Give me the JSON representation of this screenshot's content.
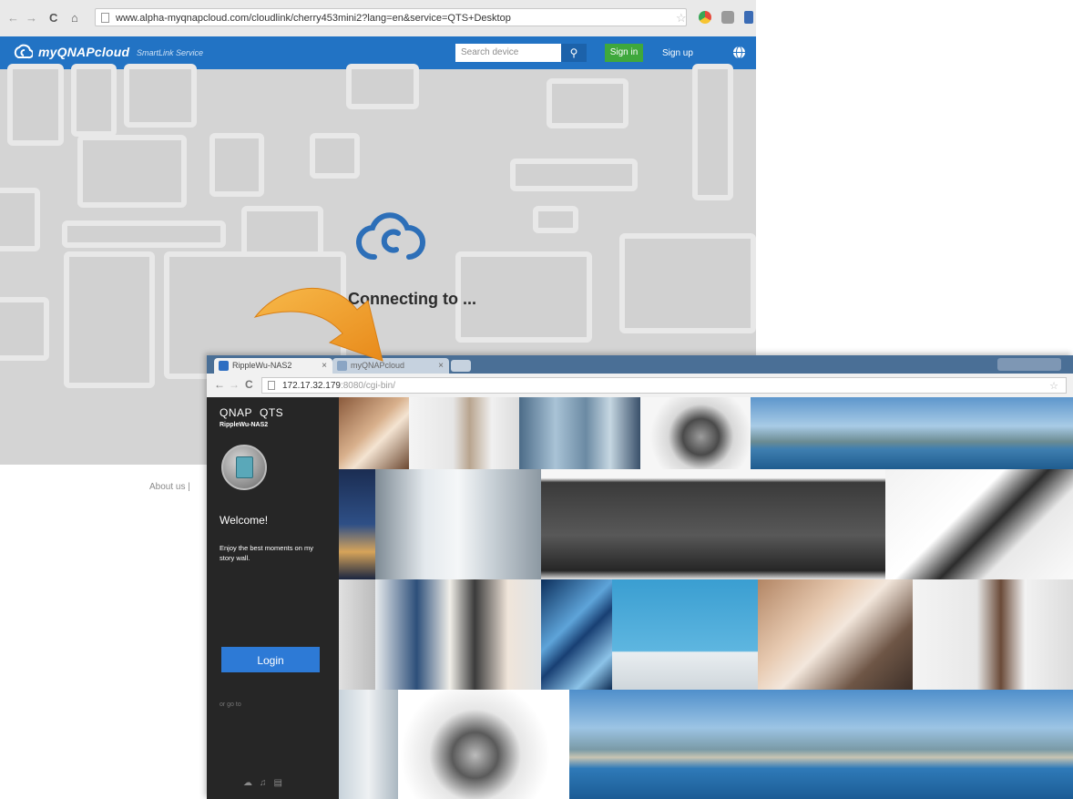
{
  "bg_browser": {
    "url": "www.alpha-myqnapcloud.com/cloudlink/cherry453mini2?lang=en&service=QTS+Desktop",
    "header": {
      "brand": "myQNAPcloud",
      "tagline": "SmartLink Service",
      "search_placeholder": "Search device",
      "signin_label": "Sign in",
      "signup_label": "Sign up"
    },
    "status_text": "Connecting to ...",
    "footer_link": "About us"
  },
  "fg_browser": {
    "tabs": [
      {
        "label": "RippleWu-NAS2"
      },
      {
        "label": "myQNAPcloud"
      }
    ],
    "url_host": "172.17.32.179",
    "url_rest": ":8080/cgi-bin/",
    "sidebar": {
      "brand": "QNAP",
      "product": "QTS",
      "device_name": "RippleWu-NAS2",
      "welcome": "Welcome!",
      "message": "Enjoy the best moments on my story wall.",
      "login_label": "Login",
      "or_go_to": "or go to"
    }
  },
  "colors": {
    "header_blue": "#2273c4",
    "signin_green": "#3fa83c",
    "login_blue": "#2d7ad6",
    "arrow_orange": "#f0a22e",
    "sidebar_dark": "#262626"
  },
  "icons": [
    "back-icon",
    "forward-icon",
    "reload-icon",
    "home-icon",
    "star-icon",
    "search-icon",
    "globe-icon",
    "cloud-icon",
    "nas-icon"
  ]
}
